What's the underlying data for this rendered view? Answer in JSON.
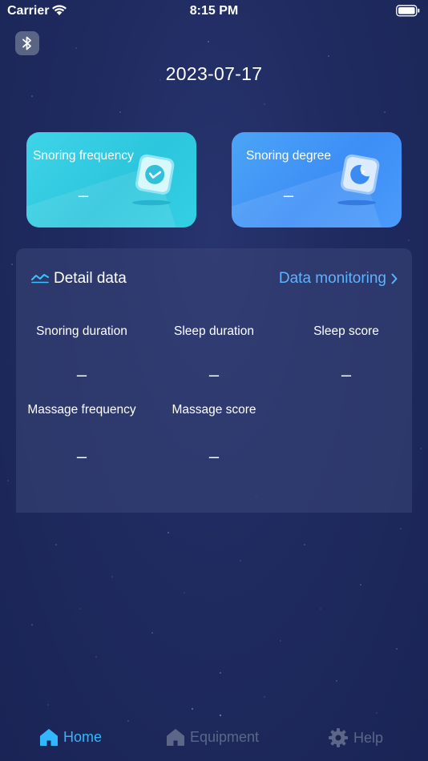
{
  "status_bar": {
    "carrier": "Carrier",
    "time": "8:15 PM"
  },
  "header": {
    "date": "2023-07-17"
  },
  "cards": {
    "snoring_frequency": {
      "label": "Snoring frequency",
      "value": "–"
    },
    "snoring_degree": {
      "label": "Snoring degree",
      "value": "–"
    }
  },
  "detail": {
    "title": "Detail data",
    "link_label": "Data monitoring",
    "metrics": [
      {
        "label": "Snoring duration",
        "value": "–"
      },
      {
        "label": "Sleep duration",
        "value": "–"
      },
      {
        "label": "Sleep score",
        "value": "–"
      },
      {
        "label": "Massage frequency",
        "value": "–"
      },
      {
        "label": "Massage score",
        "value": "–"
      }
    ]
  },
  "tab_bar": {
    "home": "Home",
    "equipment": "Equipment",
    "help": "Help"
  },
  "colors": {
    "background": "#1f2a5f",
    "card_frequency": "#2cc6dd",
    "card_degree": "#3d8ef6",
    "accent_link": "#5ab4ff",
    "tab_active": "#32b7ff",
    "tab_inactive": "#5c6788"
  }
}
